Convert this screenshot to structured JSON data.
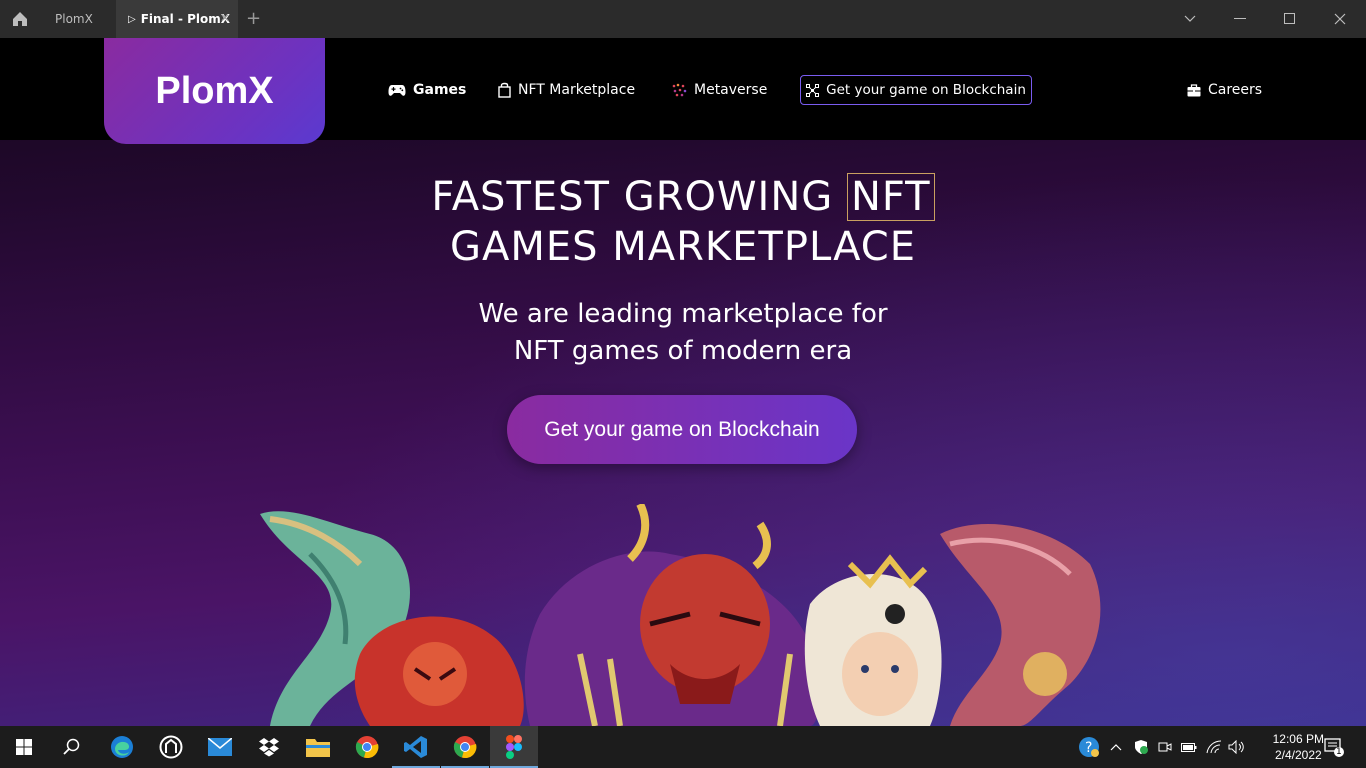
{
  "window": {
    "tabs": [
      {
        "label": "PlomX",
        "active": false
      },
      {
        "label": "Final - PlomX",
        "active": true
      }
    ]
  },
  "site": {
    "logo": "PlomX",
    "nav": {
      "games": "Games",
      "nft_marketplace": "NFT Marketplace",
      "metaverse": "Metaverse",
      "blockchain": "Get your game on Blockchain",
      "careers": "Careers"
    },
    "hero": {
      "title_part1": "FASTEST GROWING ",
      "title_highlight": "NFT",
      "title_line2": "GAMES MARKETPLACE",
      "subtitle_line1": "We are leading marketplace for",
      "subtitle_line2": "NFT games of modern era",
      "cta": "Get your game on Blockchain"
    },
    "colors": {
      "accent": "#7a5cf0",
      "gradient_start": "#8a2ba0",
      "gradient_end": "#6a35c8",
      "highlight_border": "#c9a060"
    }
  },
  "taskbar": {
    "apps": [
      "start-icon",
      "search-icon",
      "edge-icon",
      "app-icon",
      "mail-icon",
      "dropbox-icon",
      "file-explorer-icon",
      "chrome-icon",
      "vscode-icon",
      "chrome-icon",
      "figma-icon"
    ],
    "time": "12:06 PM",
    "date": "2/4/2022",
    "notifications": "1"
  }
}
